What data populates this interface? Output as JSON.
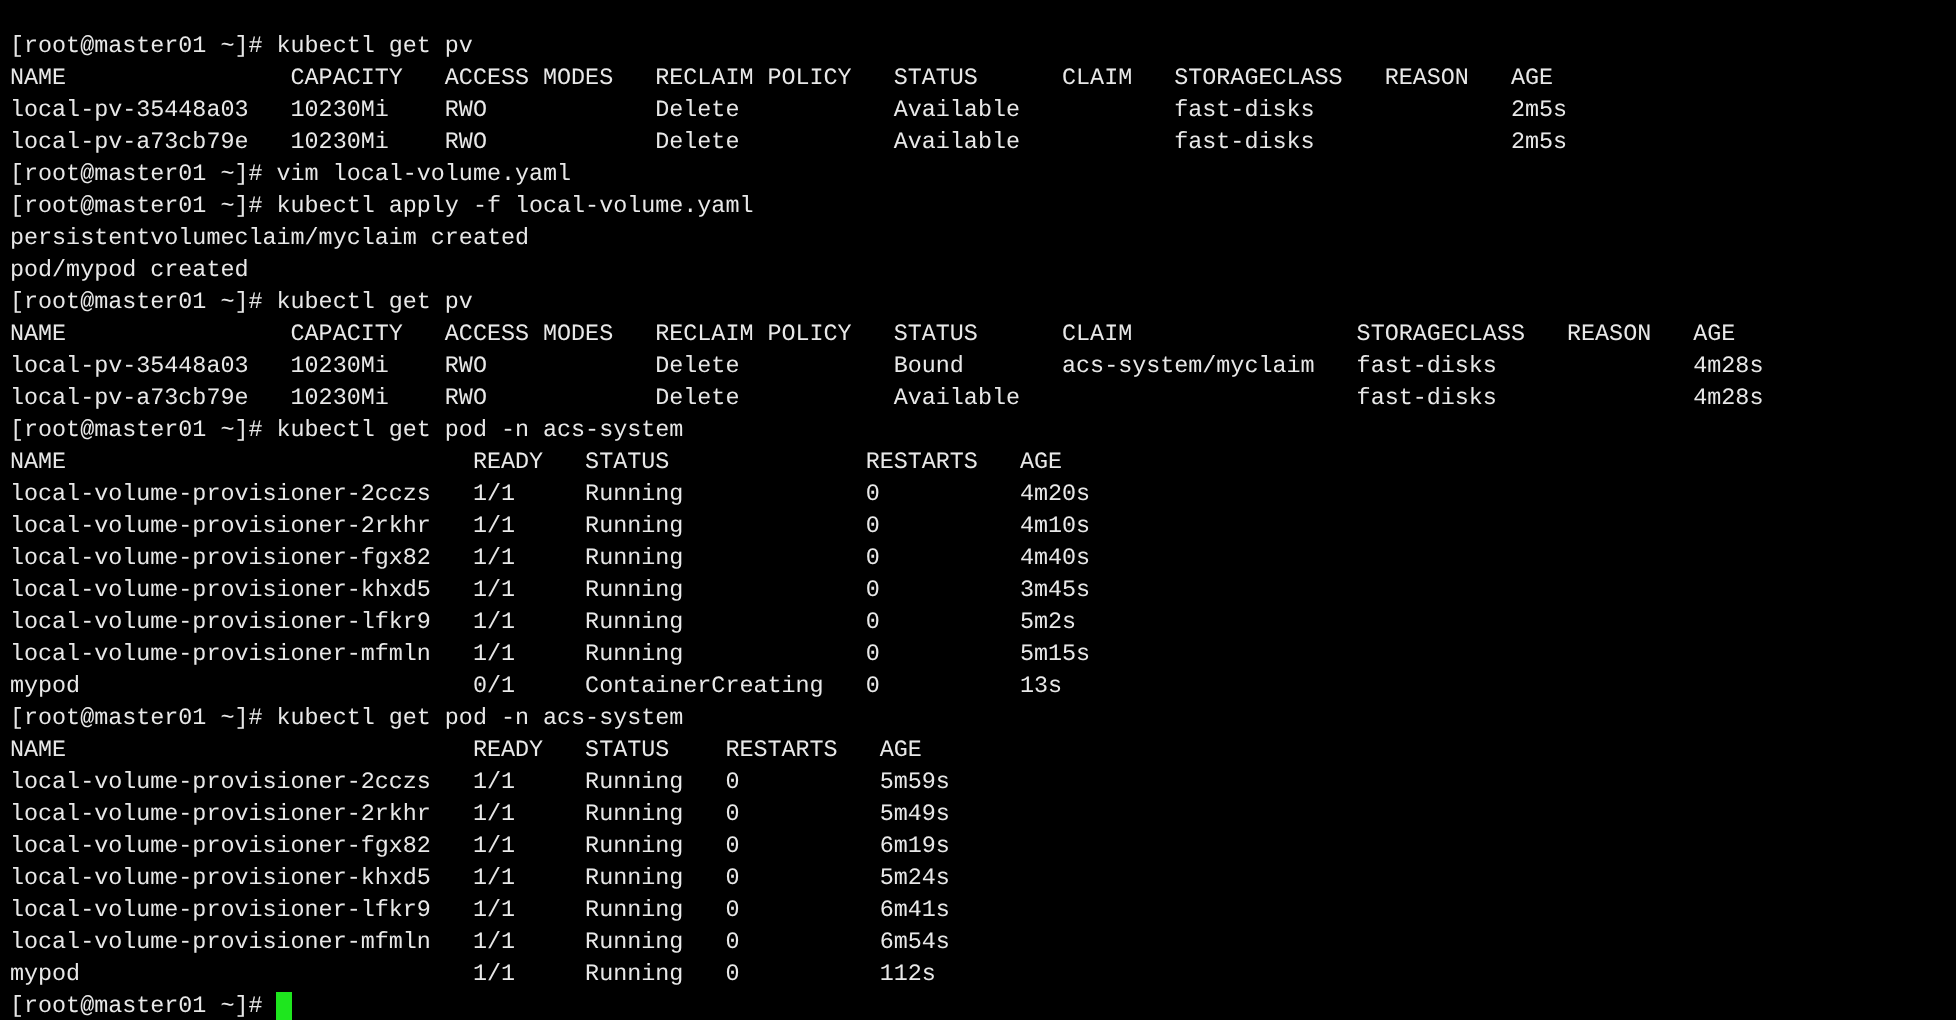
{
  "terminal": {
    "lines": [
      "[root@master01 ~]# kubectl get pv",
      "NAME                CAPACITY   ACCESS MODES   RECLAIM POLICY   STATUS      CLAIM   STORAGECLASS   REASON   AGE",
      "local-pv-35448a03   10230Mi    RWO            Delete           Available           fast-disks              2m5s",
      "local-pv-a73cb79e   10230Mi    RWO            Delete           Available           fast-disks              2m5s",
      "[root@master01 ~]# vim local-volume.yaml",
      "[root@master01 ~]# kubectl apply -f local-volume.yaml",
      "persistentvolumeclaim/myclaim created",
      "pod/mypod created",
      "[root@master01 ~]# kubectl get pv",
      "NAME                CAPACITY   ACCESS MODES   RECLAIM POLICY   STATUS      CLAIM                STORAGECLASS   REASON   AGE",
      "local-pv-35448a03   10230Mi    RWO            Delete           Bound       acs-system/myclaim   fast-disks              4m28s",
      "local-pv-a73cb79e   10230Mi    RWO            Delete           Available                        fast-disks              4m28s",
      "[root@master01 ~]# kubectl get pod -n acs-system",
      "NAME                             READY   STATUS              RESTARTS   AGE",
      "local-volume-provisioner-2cczs   1/1     Running             0          4m20s",
      "local-volume-provisioner-2rkhr   1/1     Running             0          4m10s",
      "local-volume-provisioner-fgx82   1/1     Running             0          4m40s",
      "local-volume-provisioner-khxd5   1/1     Running             0          3m45s",
      "local-volume-provisioner-lfkr9   1/1     Running             0          5m2s",
      "local-volume-provisioner-mfmln   1/1     Running             0          5m15s",
      "mypod                            0/1     ContainerCreating   0          13s",
      "[root@master01 ~]# kubectl get pod -n acs-system",
      "NAME                             READY   STATUS    RESTARTS   AGE",
      "local-volume-provisioner-2cczs   1/1     Running   0          5m59s",
      "local-volume-provisioner-2rkhr   1/1     Running   0          5m49s",
      "local-volume-provisioner-fgx82   1/1     Running   0          6m19s",
      "local-volume-provisioner-khxd5   1/1     Running   0          5m24s",
      "local-volume-provisioner-lfkr9   1/1     Running   0          6m41s",
      "local-volume-provisioner-mfmln   1/1     Running   0          6m54s",
      "mypod                            1/1     Running   0          112s"
    ],
    "prompt": "[root@master01 ~]#"
  }
}
